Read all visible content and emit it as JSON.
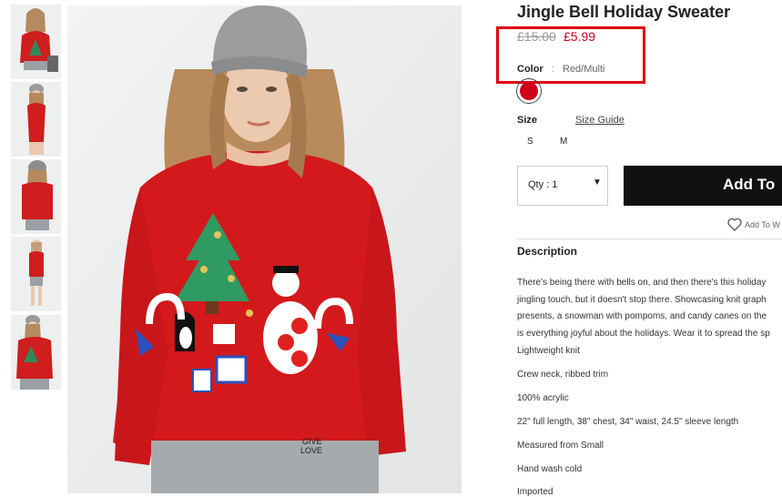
{
  "product": {
    "title": "Jingle Bell Holiday Sweater",
    "price_original": "£15.00",
    "price_sale": "£5.99",
    "color_label": "Color",
    "color_separator": ":",
    "color_value": "Red/Multi",
    "swatch_color": "#d0021b",
    "size_label": "Size",
    "size_guide": "Size Guide",
    "sizes": [
      "S",
      "M"
    ],
    "qty_label": "Qty : 1",
    "add_button": "Add To",
    "wishlist": "Add To W",
    "description_heading": "Description",
    "description_lines": [
      "There's being there with bells on, and then there's this holiday",
      "jingling touch, but it doesn't stop there. Showcasing knit graph",
      "presents, a snowman with pompoms, and candy canes on the",
      "is everything joyful about the holidays. Wear it to spread the sp"
    ],
    "details": [
      "Lightweight knit",
      "Crew neck, ribbed trim",
      "100% acrylic",
      "22\" full length, 38\" chest, 34\" waist, 24.5\" sleeve length",
      "Measured from Small",
      "Hand wash cold",
      "Imported"
    ]
  },
  "images": {
    "thumbnails": [
      "front-sitting",
      "side",
      "back",
      "full-body",
      "detail"
    ],
    "main_alt_icon": "model-photo",
    "pants_text": "GIVE LOVE"
  },
  "colors": {
    "accent_red": "#d0021b",
    "highlight": "#e0000f",
    "button_bg": "#111111"
  }
}
